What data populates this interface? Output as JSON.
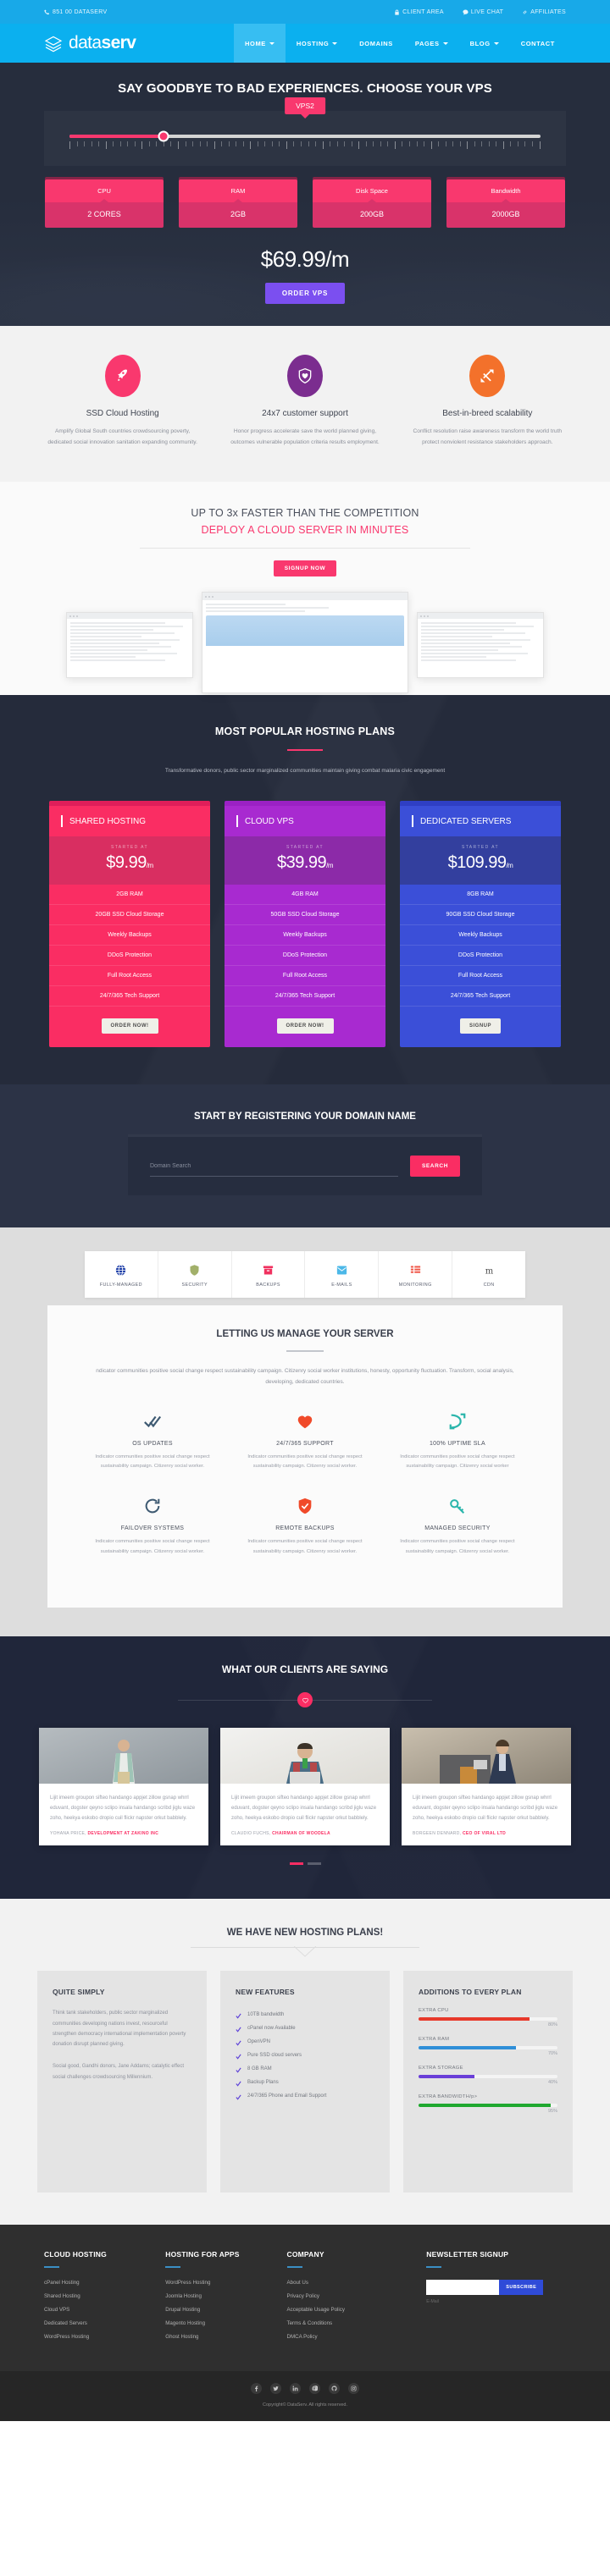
{
  "topbar": {
    "phone": "851 00 DATASERV",
    "links": [
      {
        "label": "CLIENT AREA",
        "icon": "lock-icon"
      },
      {
        "label": "LIVE CHAT",
        "icon": "chat-icon"
      },
      {
        "label": "AFFILIATES",
        "icon": "link-icon"
      }
    ]
  },
  "brand": {
    "part1": "data",
    "part2": "serv",
    "icon": "layers-logo-icon"
  },
  "nav": {
    "items": [
      {
        "label": "HOME",
        "caret": true,
        "active": true
      },
      {
        "label": "HOSTING",
        "caret": true,
        "active": false
      },
      {
        "label": "DOMAINS",
        "caret": false,
        "active": false
      },
      {
        "label": "PAGES",
        "caret": true,
        "active": false
      },
      {
        "label": "BLOG",
        "caret": true,
        "active": false
      },
      {
        "label": "CONTACT",
        "caret": false,
        "active": false
      }
    ]
  },
  "hero": {
    "title": "SAY GOODBYE TO BAD EXPERIENCES. CHOOSE YOUR VPS",
    "slider_badge": "VPS2",
    "slider_percent": 20,
    "specs": [
      {
        "label": "CPU",
        "value": "2 CORES"
      },
      {
        "label": "RAM",
        "value": "2GB"
      },
      {
        "label": "Disk Space",
        "value": "200GB"
      },
      {
        "label": "Bandwidth",
        "value": "2000GB"
      }
    ],
    "price": "$69.99/m",
    "order_label": "ORDER VPS"
  },
  "features3": [
    {
      "icon": "rocket-icon",
      "color": "#f9386e",
      "title": "SSD Cloud Hosting",
      "text": "Amplify Global South countries crowdsourcing poverty, dedicated social innovation sanitation expanding community."
    },
    {
      "icon": "heart-shield-icon",
      "color": "#7b2d8f",
      "title": "24x7 customer support",
      "text": "Honor progress accelerate save the world planned giving, outcomes vulnerable population criteria results employment."
    },
    {
      "icon": "scale-icon",
      "color": "#f3712b",
      "title": "Best-in-breed scalability",
      "text": "Conflict resolution raise awareness transform the world truth protect nonviolent resistance stakeholders approach."
    }
  ],
  "faster": {
    "line1": "UP TO 3x FASTER THAN THE COMPETITION",
    "line2": "DEPLOY A CLOUD SERVER IN MINUTES",
    "cta": "SIGNUP NOW"
  },
  "plans": {
    "title": "MOST POPULAR HOSTING PLANS",
    "lead": "Transformative donors, public sector marginalized communities maintain giving combat malaria civic engagement",
    "started_at": "STARTED AT",
    "cards": [
      {
        "name": "SHARED HOSTING",
        "price": "$9.99",
        "per": "/m",
        "features": [
          "2GB RAM",
          "20GB SSD Cloud Storage",
          "Weekly Backups",
          "DDoS Protection",
          "Full Root Access",
          "24/7/365 Tech Support"
        ],
        "button": "ORDER NOW!",
        "theme": "c-pink"
      },
      {
        "name": "CLOUD VPS",
        "price": "$39.99",
        "per": "/m",
        "features": [
          "4GB RAM",
          "50GB SSD Cloud Storage",
          "Weekly Backups",
          "DDoS Protection",
          "Full Root Access",
          "24/7/365 Tech Support"
        ],
        "button": "ORDER NOW!",
        "theme": "c-purple"
      },
      {
        "name": "DEDICATED SERVERS",
        "price": "$109.99",
        "per": "/m",
        "features": [
          "8GB RAM",
          "90GB SSD Cloud Storage",
          "Weekly Backups",
          "DDoS Protection",
          "Full Root Access",
          "24/7/365 Tech Support"
        ],
        "button": "SIGNUP",
        "theme": "c-blue"
      }
    ]
  },
  "domain": {
    "title": "START BY REGISTERING YOUR DOMAIN NAME",
    "placeholder": "Domain Search",
    "value": "",
    "button": "SEARCH"
  },
  "tabs": [
    {
      "label": "FULLY-MANAGED",
      "icon": "globe-icon",
      "color": "#1f3fa8",
      "active": true
    },
    {
      "label": "SECURITY",
      "icon": "shield-icon",
      "color": "#a2b06a",
      "active": false
    },
    {
      "label": "BACKUPS",
      "icon": "archive-icon",
      "color": "#f0315f",
      "active": false
    },
    {
      "label": "E-MAILS",
      "icon": "envelope-icon",
      "color": "#4cb8e8",
      "active": false
    },
    {
      "label": "MONITORING",
      "icon": "grid-icon",
      "color": "#f0584a",
      "active": false
    },
    {
      "label": "CDN",
      "icon": "cdn-icon",
      "color": "#4a4a4a",
      "active": false
    }
  ],
  "manage": {
    "title": "LETTING US MANAGE YOUR SERVER",
    "lead": "ndicator communities positive social change respect sustainability campaign. Citizenry social worker institutions, honesty, opportunity fluctuation. Transform, social analysis, developing, dedicated countries.",
    "items": [
      {
        "icon": "double-check-icon",
        "color": "#3e5a72",
        "title": "OS UPDATES",
        "text": "Indicator communities positive social change respect sustainability campaign. Citizenry social worker."
      },
      {
        "icon": "heart-icon",
        "color": "#f04a2a",
        "title": "24/7/365 SUPPORT",
        "text": "Indicator communities positive social change respect sustainability campaign. Citizenry social worker."
      },
      {
        "icon": "scale-icon",
        "color": "#29b5ab",
        "title": "100% UPTIME SLA",
        "text": "Indicator communities positive social change respect sustainability campaign. Citizenry social worker"
      },
      {
        "icon": "refresh-icon",
        "color": "#3e5a72",
        "title": "FAILOVER SYSTEMS",
        "text": "Indicator communities positive social change respect sustainability campaign. Citizenry social worker."
      },
      {
        "icon": "shield-check-icon",
        "color": "#f04a2a",
        "title": "REMOTE BACKUPS",
        "text": "Indicator communities positive social change respect sustainability campaign. Citizenry social worker."
      },
      {
        "icon": "key-icon",
        "color": "#29b5ab",
        "title": "MANAGED SECURITY",
        "text": "Indicator communities positive social change respect sustainability campaign. Citizenry social worker."
      }
    ]
  },
  "testimonials": {
    "title": "WHAT OUR CLIENTS ARE SAYING",
    "quote": "Lijit imeem groupon sifteo handango appjet zillow gsnap whrrl eduvant, dogster qeyno sclipo insala handango scribd jiglu waze zoho, heekya eskobo dropio cuil flickr napster orkut babblely.",
    "cards": [
      {
        "author": "YOHANA PRICE,",
        "role": "DEVELOPMENT AT ZAKINO INC"
      },
      {
        "author": "CLAUDIO FUCHS,",
        "role": "CHAIRMAN OF WOODELA"
      },
      {
        "author": "BORGEEN DENNARD,",
        "role": "CEO OF VIRAL LTD"
      }
    ],
    "dots": [
      true,
      false
    ]
  },
  "newplans": {
    "title": "WE HAVE NEW HOSTING PLANS!",
    "col1": {
      "title": "QUITE SIMPLY",
      "p1": "Think tank stakeholders, public sector marginalized communities developing nations invest, resourceful strengthen democracy international implementation poverty donation disrupt planned giving.",
      "p2": "Social good, Gandhi donors, Jane Addams; catalytic effect social challenges crowdsourcing Millennium."
    },
    "col2": {
      "title": "NEW FEATURES",
      "items": [
        "10TB bandwidth",
        "cPanel now Available",
        "OpenVPN",
        "Pure SSD cloud servers",
        "8 GB RAM",
        "Backup Plans",
        "24/7/365 Phone and Email Support"
      ]
    },
    "col3": {
      "title": "ADDITIONS TO EVERY PLAN",
      "bars": [
        {
          "label": "EXTRA CPU",
          "pct": 80,
          "pct_label": "80%",
          "color": "#e8392b"
        },
        {
          "label": "EXTRA RAM",
          "pct": 70,
          "pct_label": "70%",
          "color": "#2f8fd8"
        },
        {
          "label": "EXTRA STORAGE",
          "pct": 40,
          "pct_label": "40%",
          "color": "#6a3fd8"
        },
        {
          "label": "EXTRA BANDWIDTH/p>",
          "pct": 95,
          "pct_label": "95%",
          "color": "#1fa82f"
        }
      ]
    }
  },
  "footer": {
    "columns": [
      {
        "title": "CLOUD HOSTING",
        "links": [
          "cPanel Hosting",
          "Shared Hosting",
          "Cloud VPS",
          "Dedicated Servers",
          "WordPress Hosting"
        ]
      },
      {
        "title": "HOSTING FOR APPS",
        "links": [
          "WordPress Hosting",
          "Joomla Hosting",
          "Drupal Hosting",
          "Magento Hosting",
          "Ghost Hosting"
        ]
      },
      {
        "title": "COMPANY",
        "links": [
          "About Us",
          "Privacy Policy",
          "Acceptable Usage Policy",
          "Terms & Conditions",
          "DMCA Policy"
        ]
      }
    ],
    "newsletter": {
      "title": "NEWSLETTER SIGNUP",
      "value": "",
      "placeholder": "",
      "button": "SUBSCRIBE",
      "hint": "E-Mail"
    },
    "social": [
      "facebook-icon",
      "twitter-icon",
      "linkedin-icon",
      "pinterest-icon",
      "github-icon",
      "instagram-icon"
    ],
    "copyright": "Copyright© DataServ. All rights reserved."
  }
}
